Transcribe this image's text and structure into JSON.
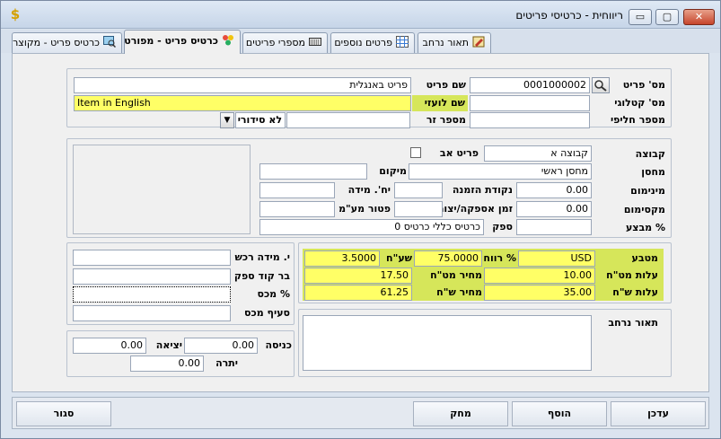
{
  "window": {
    "title": "ריווחית - כרטיסי פריטים",
    "minimize_glyph": "▭",
    "maximize_glyph": "▢",
    "close_glyph": "✕",
    "app_icon_glyph": "$"
  },
  "tabs": [
    {
      "label": "תאור נרחב"
    },
    {
      "label": "פרטים נוספים"
    },
    {
      "label": "מספרי פריטים"
    },
    {
      "label": "כרטיס פריט - מפורט"
    },
    {
      "label": "כרטיס פריט - מקוצר"
    }
  ],
  "header": {
    "item_no_label": "מס' פריט",
    "item_no_value": "0001000002",
    "item_name_label": "שם פריט",
    "item_name_value": "פריט באנגלית",
    "catalog_no_label": "מס' קטלוגי",
    "catalog_no_value": "",
    "foreign_name_label": "שם לועזי",
    "foreign_name_value": "Item in English",
    "alt_no_label": "מספר חליפי",
    "alt_no_value": "",
    "foreign_no_label": "מספר זר",
    "foreign_no_value": "",
    "serial_value": "לא סידורי",
    "serial_dropdown_glyph": "▼"
  },
  "details": {
    "group_label": "קבוצה",
    "group_value": "קבוצה א",
    "parent_item_label": "פריט אב",
    "warehouse_label": "מחסן",
    "warehouse_value": "מחסן ראשי",
    "location_label": "מיקום",
    "location_value": "",
    "minimum_label": "מינימום",
    "minimum_value": "0.00",
    "order_point_label": "נקודת הזמנה",
    "order_point_value": "",
    "unit_label": "יח'. מידה",
    "unit_value": "",
    "maximum_label": "מקסימום",
    "maximum_value": "0.00",
    "lead_time_label": "זמן אספקה/יצור",
    "lead_time_value": "",
    "vat_exempt_label": "פטור מע\"מ",
    "vat_exempt_value": "",
    "promo_label": "% מבצע",
    "promo_value": "",
    "supplier_label": "ספק",
    "supplier_value": "כרטיס כללי כרטיס 0"
  },
  "pricing": {
    "currency_label": "מטבע",
    "currency_value": "USD",
    "profit_label": "% רווח",
    "profit_value": "75.0000",
    "rate_label": "שע\"ח",
    "rate_value": "3.5000",
    "cost_fc_label": "עלות מט\"ח",
    "cost_fc_value": "10.00",
    "price_fc_label": "מחיר מט\"ח",
    "price_fc_value": "17.50",
    "cost_ils_label": "עלות ש\"ח",
    "cost_ils_value": "35.00",
    "price_ils_label": "מחיר ש\"ח",
    "price_ils_value": "61.25"
  },
  "purchase": {
    "purchase_unit_label": "י. מידה רכש",
    "purchase_unit_value": "",
    "supplier_barcode_label": "בר קוד ספק",
    "supplier_barcode_value": "",
    "customs_pct_label": "% מכס",
    "customs_pct_value": "",
    "customs_section_label": "סעיף מכס",
    "customs_section_value": ""
  },
  "description": {
    "label": "תאור נרחב",
    "value": ""
  },
  "stock": {
    "in_label": "כניסה",
    "in_value": "0.00",
    "out_label": "יציאה",
    "out_value": "0.00",
    "balance_label": "יתרה",
    "balance_value": "0.00"
  },
  "buttons": {
    "update": "עדכן",
    "add": "הוסף",
    "delete": "מחק",
    "close": "סגור"
  }
}
